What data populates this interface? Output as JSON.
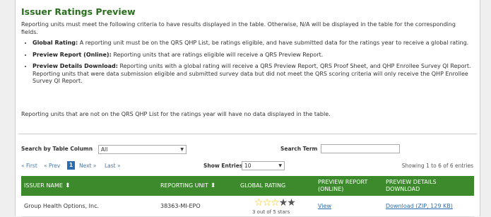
{
  "title": "Issuer Ratings Preview",
  "intro": "Reporting units must meet the following criteria to have results displayed in the table. Otherwise, N/A will be displayed in the table for the corresponding fields.",
  "criteria": [
    {
      "term": "Global Rating:",
      "text": "A reporting unit must be on the QRS QHP List, be ratings eligible, and have submitted data for the ratings year to receive a global rating."
    },
    {
      "term": "Preview Report (Online):",
      "text": "Reporting units that are ratings eligible will receive a QRS Preview Report."
    },
    {
      "term": "Preview Details Download:",
      "text": "Reporting units with a global rating will receive a QRS Preview Report, QRS Proof Sheet, and QHP Enrollee Survey QI Report. Reporting units that were data submission eligible and submitted survey data but did not meet the QRS scoring criteria will only receive the QHP Enrollee Survey QI Report."
    }
  ],
  "note": "Reporting units that are not on the QRS QHP List for the ratings year will have no data displayed in the table.",
  "search": {
    "column_label": "Search by Table Column",
    "column_value": "All",
    "term_label": "Search Term",
    "term_value": ""
  },
  "pager": {
    "first": "« First",
    "prev": "« Prev",
    "current": "1",
    "next": "Next »",
    "last": "Last »",
    "show_label": "Show Entries",
    "show_value": "10",
    "info": "Showing 1 to 6 of 6 entries"
  },
  "table": {
    "headers": {
      "issuer": "ISSUER NAME",
      "unit": "REPORTING UNIT",
      "rating": "GLOBAL RATING",
      "report_line1": "PREVIEW REPORT",
      "report_line2": "(ONLINE)",
      "details_line1": "PREVIEW DETAILS",
      "details_line2": "DOWNLOAD"
    },
    "rows": [
      {
        "issuer": "Group Health Options, Inc.",
        "unit": "38363-MI-EPO",
        "stars": 3,
        "max_stars": 5,
        "rating_text": "3 out of 5 stars",
        "report": "View",
        "download": "Download (ZIP, 129 KB)"
      }
    ]
  },
  "colors": {
    "title": "#2a6e1f",
    "header_bg": "#3d8a2d",
    "link": "#2b6cb0",
    "star": "#f2c200"
  }
}
